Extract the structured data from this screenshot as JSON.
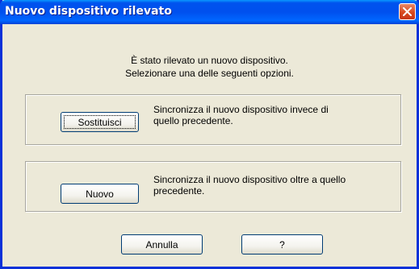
{
  "window": {
    "title": "Nuovo dispositivo rilevato"
  },
  "message": {
    "line1": "È stato rilevato un nuovo dispositivo.",
    "line2": "Selezionare una delle seguenti opzioni."
  },
  "options": [
    {
      "button_label": "Sostituisci",
      "description_line1": "Sincronizza il nuovo dispositivo invece di",
      "description_line2": "quello precedente."
    },
    {
      "button_label": "Nuovo",
      "description_line1": "Sincronizza il nuovo dispositivo oltre a quello",
      "description_line2": "precedente."
    }
  ],
  "footer": {
    "cancel_label": "Annulla",
    "help_label": "?"
  },
  "colors": {
    "titlebar": "#0053ee",
    "dialog_bg": "#ece9d8",
    "close_button": "#d8491d"
  },
  "icons": [
    "close-icon"
  ]
}
